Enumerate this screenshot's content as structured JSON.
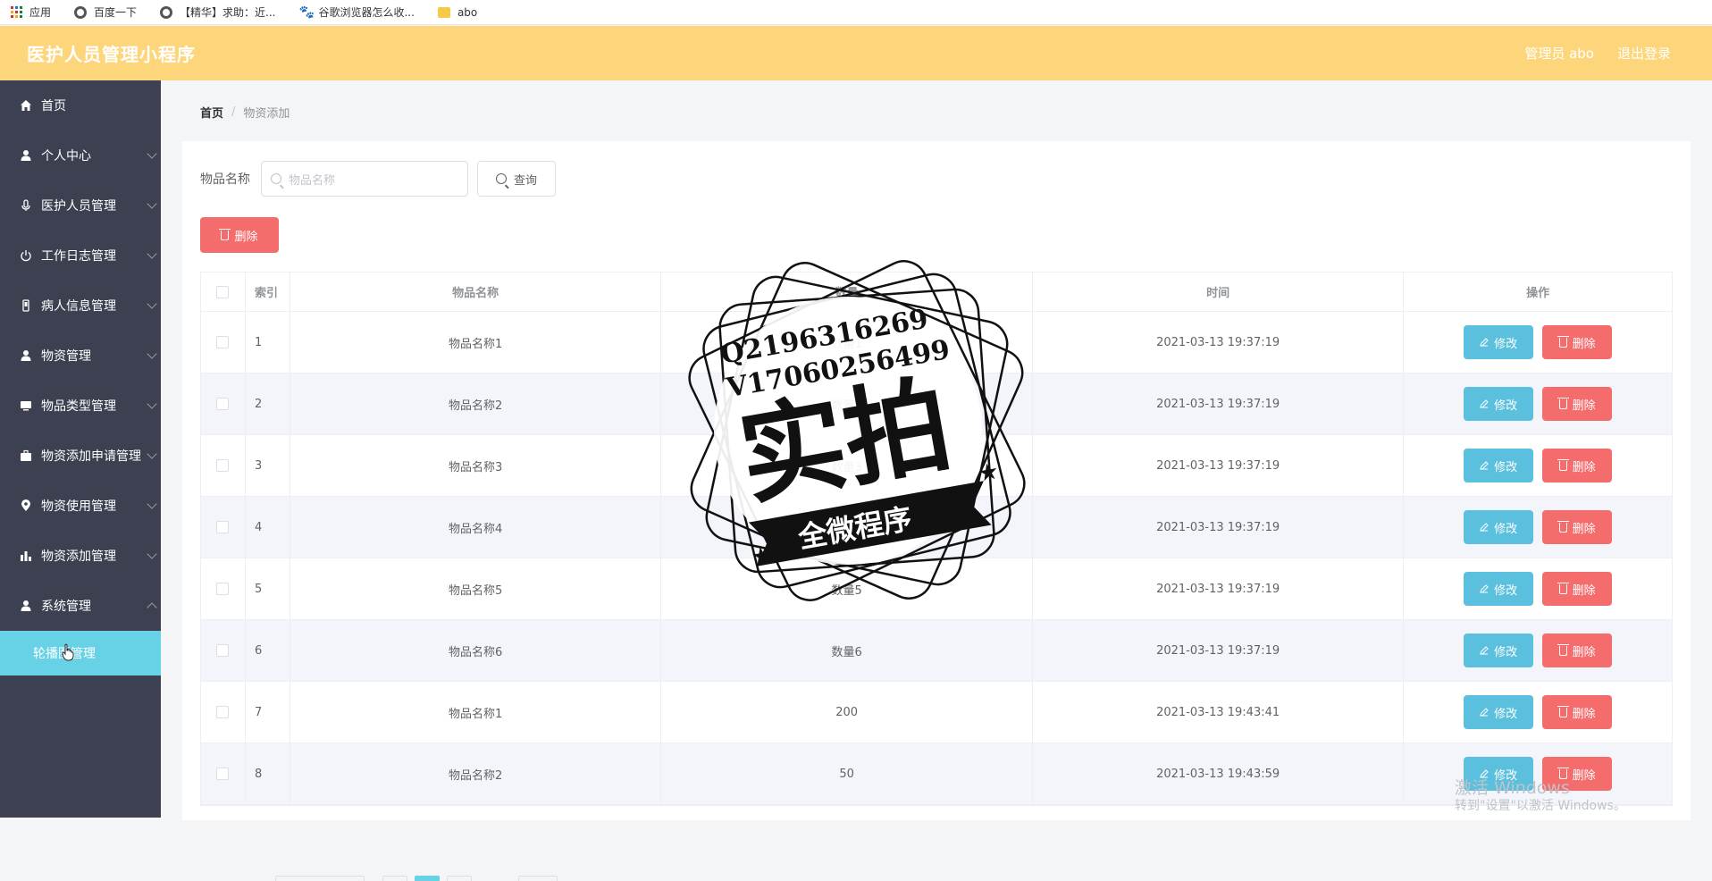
{
  "browser": {
    "bookmarks": [
      {
        "label": "应用",
        "icon": "apps-grid-icon"
      },
      {
        "label": "百度一下",
        "icon": "globe-icon"
      },
      {
        "label": "【精华】求助：近...",
        "icon": "globe-icon"
      },
      {
        "label": "谷歌浏览器怎么收...",
        "icon": "paw-icon"
      },
      {
        "label": "abo",
        "icon": "folder-icon"
      }
    ]
  },
  "header": {
    "title": "医护人员管理小程序",
    "user": "管理员 abo",
    "logout": "退出登录",
    "color": "#fdd67b"
  },
  "sidebar": {
    "items": [
      {
        "label": "首页",
        "icon": "home-icon"
      },
      {
        "label": "个人中心",
        "icon": "user-icon"
      },
      {
        "label": "医护人员管理",
        "icon": "microphone-icon"
      },
      {
        "label": "工作日志管理",
        "icon": "power-icon"
      },
      {
        "label": "病人信息管理",
        "icon": "device-icon"
      },
      {
        "label": "物资管理",
        "icon": "user-icon"
      },
      {
        "label": "物品类型管理",
        "icon": "monitor-icon"
      },
      {
        "label": "物资添加申请管理",
        "icon": "briefcase-icon"
      },
      {
        "label": "物资使用管理",
        "icon": "location-pin-icon"
      },
      {
        "label": "物资添加管理",
        "icon": "bar-chart-icon"
      },
      {
        "label": "系统管理",
        "icon": "user-icon"
      }
    ],
    "sub_item": "轮播图管理",
    "color": "#3c4051",
    "active_color": "#67d1e6"
  },
  "breadcrumb": {
    "home": "首页",
    "current": "物资添加"
  },
  "search": {
    "label": "物品名称",
    "placeholder": "物品名称",
    "button": "查询"
  },
  "toolbar": {
    "delete": "删除"
  },
  "table": {
    "headers": [
      "索引",
      "物品名称",
      "数量",
      "时间",
      "操作"
    ],
    "rows": [
      {
        "idx": "1",
        "name": "物品名称1",
        "qty": "数量1",
        "time": "2021-03-13 19:37:19"
      },
      {
        "idx": "2",
        "name": "物品名称2",
        "qty": "数量2",
        "time": "2021-03-13 19:37:19"
      },
      {
        "idx": "3",
        "name": "物品名称3",
        "qty": "数量3",
        "time": "2021-03-13 19:37:19"
      },
      {
        "idx": "4",
        "name": "物品名称4",
        "qty": "数量4",
        "time": "2021-03-13 19:37:19"
      },
      {
        "idx": "5",
        "name": "物品名称5",
        "qty": "数量5",
        "time": "2021-03-13 19:37:19"
      },
      {
        "idx": "6",
        "name": "物品名称6",
        "qty": "数量6",
        "time": "2021-03-13 19:37:19"
      },
      {
        "idx": "7",
        "name": "物品名称1",
        "qty": "200",
        "time": "2021-03-13 19:43:41"
      },
      {
        "idx": "8",
        "name": "物品名称2",
        "qty": "50",
        "time": "2021-03-13 19:43:59"
      }
    ],
    "edit_label": "修改",
    "delete_label": "删除"
  },
  "watermark": {
    "line1": "Q2196316269",
    "line2": "V17060256499",
    "big": "实拍",
    "ribbon": "全微程序"
  },
  "windows_activation": {
    "line1": "激活 Windows",
    "line2": "转到\"设置\"以激活 Windows。"
  }
}
